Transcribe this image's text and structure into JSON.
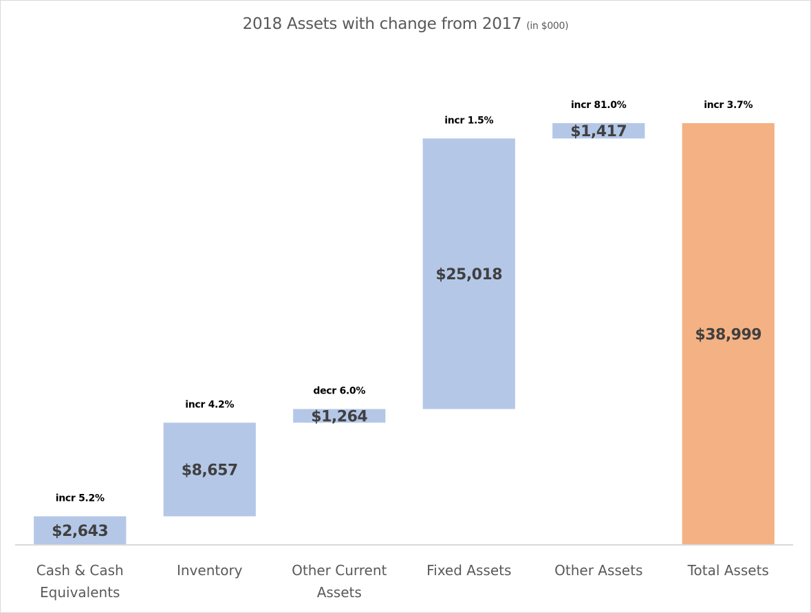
{
  "chart_data": {
    "type": "bar",
    "subtype": "waterfall",
    "title": "2018 Assets with change from 2017",
    "title_suffix": "(in $000)",
    "xlabel": "",
    "ylabel": "",
    "ylim": [
      0,
      38999
    ],
    "grid": false,
    "legend": "none",
    "categories": [
      [
        "Cash & Cash",
        "Equivalents"
      ],
      [
        "Inventory"
      ],
      [
        "Other Current",
        "Assets"
      ],
      [
        "Fixed Assets"
      ],
      [
        "Other Assets"
      ],
      [
        "Total Assets"
      ]
    ],
    "values": [
      2643,
      8657,
      1264,
      25018,
      1417,
      38999
    ],
    "is_total": [
      false,
      false,
      false,
      false,
      false,
      true
    ],
    "value_labels": [
      "$2,643",
      "$8,657",
      "$1,264",
      "$25,018",
      "$1,417",
      "$38,999"
    ],
    "change_labels": [
      "incr 5.2%",
      "incr 4.2%",
      "decr 6.0%",
      "incr 1.5%",
      "incr 81.0%",
      "incr 3.7%"
    ],
    "colors": {
      "component": "#b4c7e7",
      "total": "#f4b183",
      "axis": "#d9d9d9"
    }
  }
}
